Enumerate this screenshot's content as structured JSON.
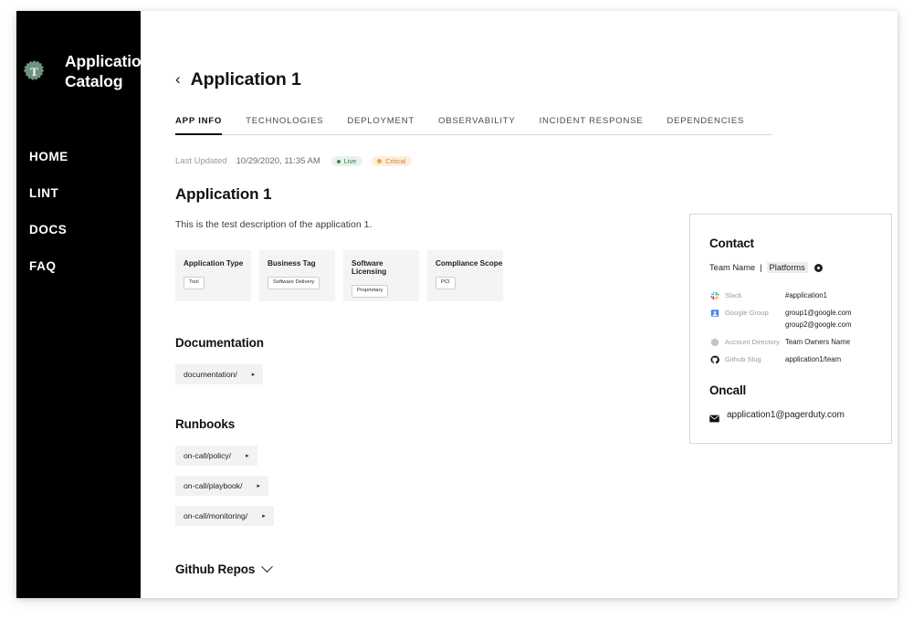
{
  "sidebar": {
    "brand_title": "Application Catalog",
    "logo_icon": "nyt-t-logo-icon",
    "items": [
      {
        "label": "HOME"
      },
      {
        "label": "LINT"
      },
      {
        "label": "DOCS"
      },
      {
        "label": "FAQ"
      }
    ]
  },
  "header": {
    "back_icon": "chevron-left-icon",
    "title": "Application 1"
  },
  "tabs": [
    {
      "label": "APP INFO",
      "active": true
    },
    {
      "label": "TECHNOLOGIES",
      "active": false
    },
    {
      "label": "DEPLOYMENT",
      "active": false
    },
    {
      "label": "OBSERVABILITY",
      "active": false
    },
    {
      "label": "INCIDENT RESPONSE",
      "active": false
    },
    {
      "label": "DEPENDENCIES",
      "active": false
    }
  ],
  "meta": {
    "last_updated_label": "Last Updated",
    "last_updated_value": "10/29/2020, 11:35 AM",
    "status_badge": "Live",
    "severity_badge": "Critical",
    "status_color": "#2e8b57",
    "severity_color": "#f2a23c"
  },
  "app": {
    "name": "Application 1",
    "description": "This is the test description of the application 1."
  },
  "info_cards": [
    {
      "title": "Application Type",
      "value": "Tool"
    },
    {
      "title": "Business Tag",
      "value": "Software Delivery"
    },
    {
      "title": "Software Licensing",
      "value": "Proprietary"
    },
    {
      "title": "Compliance Scope",
      "value": "PCI"
    }
  ],
  "documentation": {
    "title": "Documentation",
    "links": [
      {
        "label": "documentation/",
        "arrow": "▸"
      }
    ]
  },
  "runbooks": {
    "title": "Runbooks",
    "links": [
      {
        "label": "on-call/policy/",
        "arrow": "▸"
      },
      {
        "label": "on-call/playbook/",
        "arrow": "▸"
      },
      {
        "label": "on-call/monitoring/",
        "arrow": "▸"
      }
    ]
  },
  "github_repos": {
    "title": "Github Repos",
    "toggle_icon": "chevron-down-icon"
  },
  "contact": {
    "title": "Contact",
    "team_name": "Team Name",
    "separator": "|",
    "team_value": "Platforms",
    "team_icon": "info-circle-icon",
    "rows": [
      {
        "icon": "slack-icon",
        "key": "Slack",
        "values": [
          "#application1"
        ]
      },
      {
        "icon": "google-group-icon",
        "key": "Google Group",
        "values": [
          "group1@google.com",
          "group2@google.com"
        ]
      },
      {
        "icon": "account-directory-icon",
        "key": "Account Directory",
        "values": [
          "Team Owners Name"
        ]
      },
      {
        "icon": "github-icon",
        "key": "Github Slug",
        "values": [
          "application1/team"
        ]
      }
    ]
  },
  "oncall": {
    "title": "Oncall",
    "icon": "envelope-icon",
    "email": "application1@pagerduty.com"
  }
}
